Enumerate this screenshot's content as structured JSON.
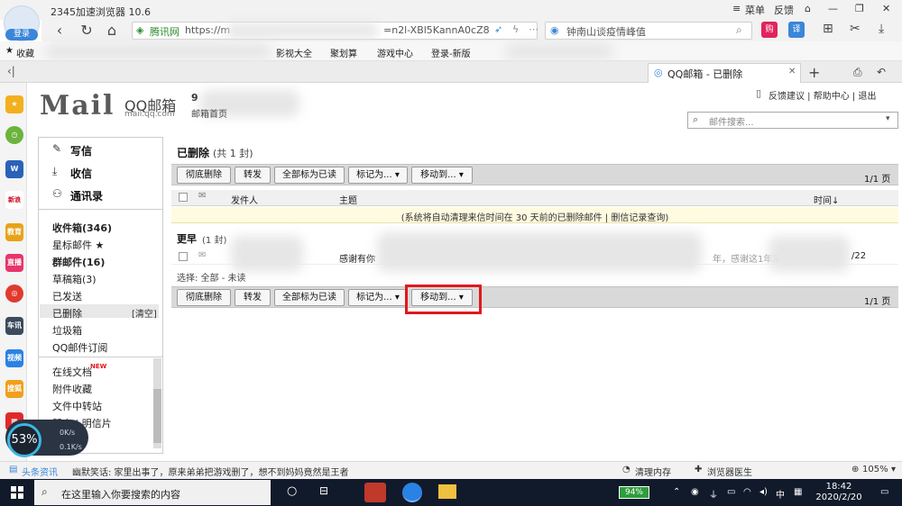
{
  "browser": {
    "title": "2345加速浏览器 10.6",
    "login_label": "登录",
    "menu_label": "菜单",
    "feedback_label": "反馈",
    "url_site": "腾讯网",
    "url_text": "https://m",
    "url_tail": "=n2l-XBl5KannA0cZ8",
    "search_text": "钟南山谈疫情峰值",
    "bookmarks": [
      "收藏",
      "影视大全",
      "聚划算",
      "游戏中心",
      "登录-新版"
    ],
    "tab_label": "QQ邮箱 - 已删除"
  },
  "mail": {
    "logo": "Mail",
    "logo_sub": "QQ邮箱",
    "logo_domain": "mail.qq.com",
    "mail_home": "邮箱首页",
    "top_links": "反馈建议 | 帮助中心 | 退出",
    "search_placeholder": "邮件搜索...",
    "nav": {
      "write": "写信",
      "receive": "收信",
      "contacts": "通讯录"
    },
    "folders": [
      "收件箱(346)",
      "星标邮件 ★",
      "群邮件(16)",
      "草稿箱(3)",
      "已发送",
      "已删除",
      "垃圾箱",
      "QQ邮件订阅"
    ],
    "clear_link": "[清空]",
    "extra_folders": [
      "在线文档",
      "附件收藏",
      "文件中转站",
      "贺卡 | 明信片"
    ],
    "new_badge": "NEW",
    "folder_title": "已删除",
    "folder_count": "(共 1 封)",
    "toolbar": {
      "delete_forever": "彻底删除",
      "forward": "转发",
      "mark_all_read": "全部标为已读",
      "mark_as": "标记为... ▾",
      "move_to": "移动到... ▾",
      "pager": "1/1 页"
    },
    "columns": {
      "sender": "发件人",
      "subject": "主题",
      "time": "时间↓"
    },
    "notice": "(系统将自动清理来信时间在 30 天前的已删除邮件 | 删信记录查询)",
    "group_title": "更早",
    "group_count": "(1 封)",
    "row": {
      "subject": "感谢有你",
      "extra": "年，感谢这1年来",
      "date": "/22"
    },
    "select_row": "选择:  全部 -  未读"
  },
  "statusbar": {
    "news": "头条资讯",
    "joke": "幽默笑话: 家里出事了，原来弟弟把游戏删了，想不到妈妈竟然是王者",
    "clean": "清理内存",
    "doctor": "浏览器医生",
    "zoom": "105%"
  },
  "taskbar": {
    "search_text": "在这里输入你要搜索的内容",
    "battery": "94%",
    "ime": "中",
    "time": "18:42",
    "date": "2020/2/20"
  },
  "netwidget": {
    "percent": "53%",
    "up": "0K/s",
    "down": "0.1K/s"
  },
  "sidebar_labels": [
    "新浪",
    "教育",
    "直播",
    "车讯",
    "视频",
    "搜狐"
  ],
  "colors": {
    "highlight": "#e0181e",
    "notice_bg": "#fffbe0",
    "toolbar_bg": "#d9d9d9"
  }
}
